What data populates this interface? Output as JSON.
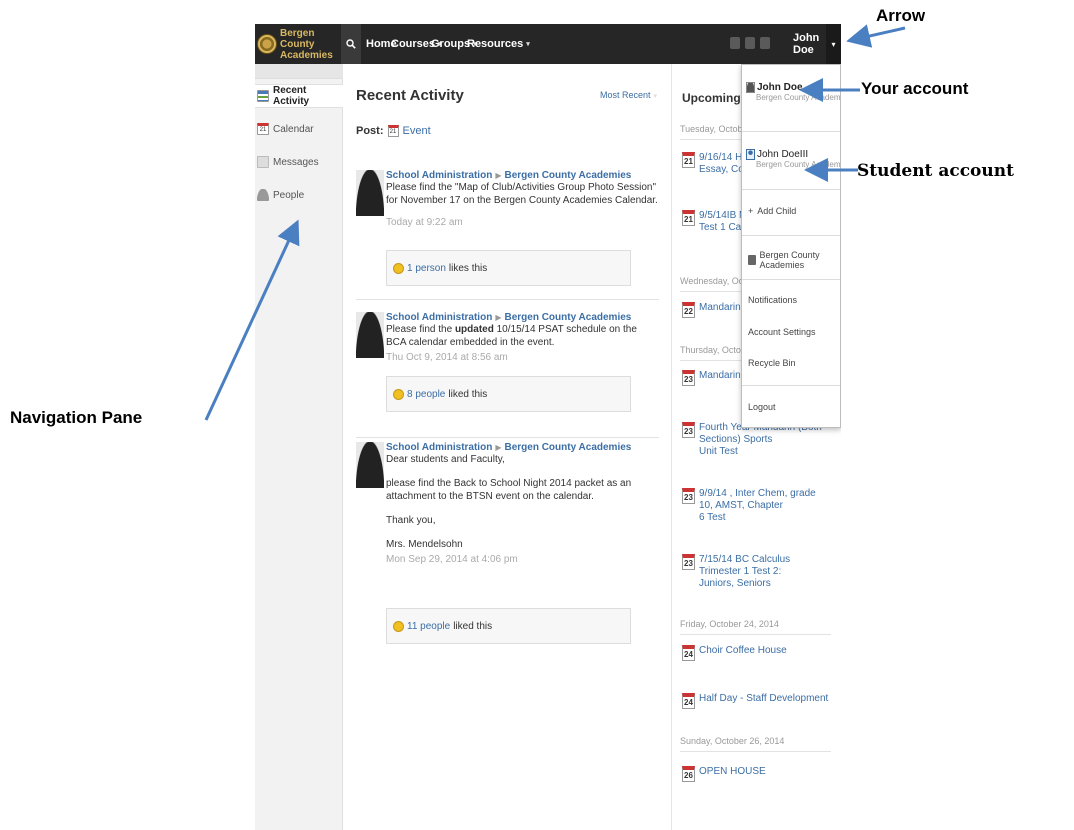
{
  "topbar": {
    "logo_line1": "Bergen County",
    "logo_line2": "Academies",
    "nav": [
      {
        "label": "Home",
        "has_caret": false
      },
      {
        "label": "Courses",
        "has_caret": true
      },
      {
        "label": "Groups",
        "has_caret": true
      },
      {
        "label": "Resources",
        "has_caret": true
      }
    ],
    "user_name": "John Doe",
    "caret_glyph": "▾"
  },
  "sidebar": {
    "items": [
      {
        "label": "Recent Activity",
        "icon": "activity-icon",
        "active": true
      },
      {
        "label": "Calendar",
        "icon": "calendar-icon",
        "active": false
      },
      {
        "label": "Messages",
        "icon": "messages-icon",
        "active": false
      },
      {
        "label": "People",
        "icon": "people-icon",
        "active": false
      }
    ],
    "calendar_icon_text": "21"
  },
  "feed": {
    "title": "Recent Activity",
    "sort_label": "Most Recent",
    "post_label": "Post:",
    "post_event_label": "Event",
    "post_event_icon_text": "21",
    "posts": [
      {
        "author": "School Administration",
        "group": "Bergen County Academies",
        "text_lines": [
          "Please find the \"Map of Club/Activities Group Photo Session\" for November 17 on the Bergen County Academies Calendar."
        ],
        "time": "Today at 9:22 am",
        "likes_link": "1 person",
        "likes_suffix": "likes this"
      },
      {
        "author": "School Administration",
        "group": "Bergen County Academies",
        "text_pre": "Please find the ",
        "text_bold": "updated",
        "text_post": " 10/15/14 PSAT schedule on the BCA calendar embedded in the event.",
        "time": "Thu Oct 9, 2014 at 8:56 am",
        "likes_link": "8 people",
        "likes_suffix": "liked this"
      },
      {
        "author": "School Administration",
        "group": "Bergen County Academies",
        "paragraphs": [
          "Dear students and Faculty,",
          "please find the Back to School Night 2014 packet as an attachment to the BTSN event on the calendar.",
          "Thank you,",
          "Mrs. Mendelsohn"
        ],
        "time": "Mon Sep 29, 2014 at 4:06 pm",
        "likes_link": "11 people",
        "likes_suffix": "liked this"
      }
    ]
  },
  "upcoming": {
    "title": "Upcoming",
    "days": [
      {
        "heading": "Tuesday, October 21,",
        "events": [
          {
            "day": "21",
            "title_lines": [
              "9/16/14 Honor",
              "Essay, Commor"
            ]
          },
          {
            "day": "21",
            "title_lines": [
              "9/5/14IB Math",
              "Test 1 Calcul"
            ]
          }
        ]
      },
      {
        "heading": "Wednesday, October",
        "events": [
          {
            "day": "22",
            "title_lines": [
              "Mandarin I Sec"
            ]
          }
        ]
      },
      {
        "heading": "Thursday, October 23",
        "events": [
          {
            "day": "23",
            "title_lines": [
              "Mandarin I Sec"
            ]
          },
          {
            "day": "23",
            "title_lines": [
              "Fourth Year Mandarin (Both Sections) Sports",
              "Unit Test"
            ]
          },
          {
            "day": "23",
            "title_lines": [
              "9/9/14 , Inter Chem, grade 10, AMST, Chapter",
              "6 Test"
            ]
          },
          {
            "day": "23",
            "title_lines": [
              "7/15/14 BC Calculus Trimester 1 Test 2:",
              "Juniors, Seniors"
            ]
          }
        ]
      },
      {
        "heading": "Friday, October 24, 2014",
        "events": [
          {
            "day": "24",
            "title_lines": [
              "Choir Coffee House"
            ]
          },
          {
            "day": "24",
            "title_lines": [
              "Half Day - Staff Development"
            ]
          }
        ]
      },
      {
        "heading": "Sunday, October 26, 2014",
        "events": [
          {
            "day": "26",
            "title_lines": [
              "OPEN HOUSE"
            ]
          }
        ]
      }
    ]
  },
  "dropdown": {
    "accounts": [
      {
        "name": "John Doe",
        "school": "Bergen County Academies"
      },
      {
        "name": "John DoeIII",
        "school": "Bergen County Academies"
      }
    ],
    "add_child": "Add Child",
    "add_glyph": "+",
    "school": "Bergen County Academies",
    "menu": [
      "Notifications",
      "Account Settings",
      "Recycle Bin"
    ],
    "logout": "Logout"
  },
  "annotations": {
    "arrow": "Arrow",
    "your_account": "Your account",
    "student_account": "Student account",
    "navigation_pane": "Navigation Pane"
  },
  "colors": {
    "topbar": "#262626",
    "link": "#3b6ea5",
    "annotation_arrow": "#4a7fc1",
    "calendar_red": "#cc3333"
  }
}
